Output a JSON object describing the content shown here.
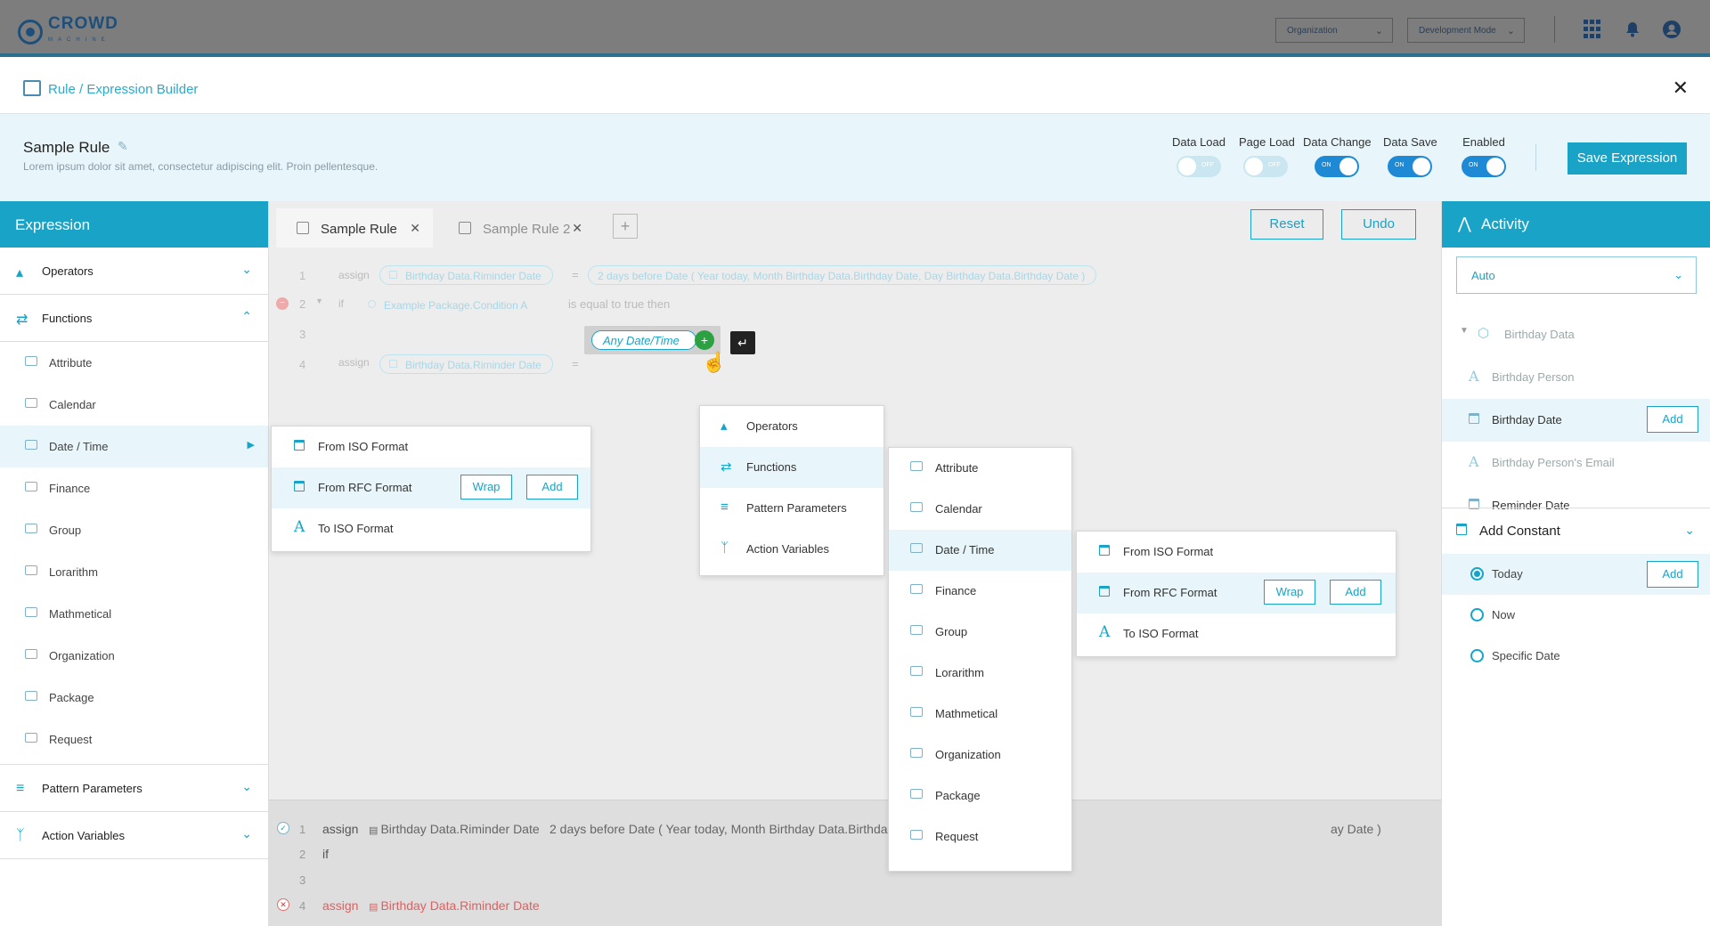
{
  "app": {
    "logo_text": "CROWD",
    "logo_sub": "MACHINE",
    "org_select": "Organization",
    "mode_select": "Development Mode"
  },
  "modal": {
    "title": "Rule / Expression Builder"
  },
  "rule": {
    "name": "Sample Rule",
    "description": "Lorem ipsum dolor sit amet, consectetur adipiscing elit. Proin pellentesque.",
    "toggles": [
      {
        "label": "Data Load",
        "state": "OFF"
      },
      {
        "label": "Page Load",
        "state": "OFF"
      },
      {
        "label": "Data Change",
        "state": "ON"
      },
      {
        "label": "Data Save",
        "state": "ON"
      },
      {
        "label": "Enabled",
        "state": "ON"
      }
    ],
    "save_label": "Save Expression"
  },
  "left": {
    "title": "Expression",
    "sections": {
      "operators": "Operators",
      "functions": "Functions",
      "pattern_parameters": "Pattern Parameters",
      "action_variables": "Action Variables"
    },
    "function_items": [
      "Attribute",
      "Calendar",
      "Date / Time",
      "Finance",
      "Group",
      "Lorarithm",
      "Mathmetical",
      "Organization",
      "Package",
      "Request"
    ],
    "active_item": "Date / Time"
  },
  "tabs": {
    "items": [
      "Sample Rule",
      "Sample Rule 2"
    ],
    "reset_label": "Reset",
    "undo_label": "Undo"
  },
  "editor": {
    "lines": {
      "l1_num": "1",
      "l1_kw": "assign",
      "l1_target": "Birthday Data.Riminder Date",
      "l1_eq": "=",
      "l1_value": "2 days before Date ( Year today, Month Birthday Data.Birthday Date, Day Birthday Data.Birthday Date )",
      "l2_num": "2",
      "l2_kw": "if",
      "l2_cond": "Example Package.Condition A",
      "l2_tail": "is equal to true then",
      "l3_num": "3",
      "l4_num": "4",
      "l4_kw": "assign",
      "l4_target": "Birthday Data.Riminder Date",
      "l4_eq": "=",
      "l4_active": "Any Date/Time"
    }
  },
  "output": {
    "o1_num": "1",
    "o1_kw": "assign",
    "o1_target": "Birthday Data.Riminder Date",
    "o1_value_a": "2 days before Date ( Year today, Month Birthday Data.Birthda",
    "o1_value_b": "ay Date )",
    "o2_num": "2",
    "o2_kw": "if",
    "o3_num": "3",
    "o4_num": "4",
    "o4_kw": "assign",
    "o4_target": "Birthday Data.Riminder Date"
  },
  "left_flyout": {
    "items": [
      "From ISO Format",
      "From RFC Format",
      "To ISO Format"
    ],
    "wrap_label": "Wrap",
    "add_label": "Add"
  },
  "ctx_menu": {
    "items": [
      "Operators",
      "Functions",
      "Pattern Parameters",
      "Action Variables"
    ]
  },
  "ctx_sub": {
    "items": [
      "Attribute",
      "Calendar",
      "Date / Time",
      "Finance",
      "Group",
      "Lorarithm",
      "Mathmetical",
      "Organization",
      "Package",
      "Request"
    ]
  },
  "ctx_flyout": {
    "items": [
      "From ISO Format",
      "From RFC Format",
      "To ISO Format"
    ],
    "wrap_label": "Wrap",
    "add_label": "Add"
  },
  "right": {
    "title": "Activity",
    "select": "Auto",
    "tree": {
      "group": "Birthday Data",
      "items": [
        "Birthday Person",
        "Birthday Date",
        "Birthday Person's Email",
        "Reminder Date"
      ],
      "add_label": "Add"
    },
    "constants_title": "Add Constant",
    "constants": [
      "Today",
      "Now",
      "Specific Date"
    ],
    "constant_add_label": "Add"
  },
  "colors": {
    "accent": "#19a3c7",
    "toggle_on": "#1e8ad6",
    "plus_green": "#2ba142",
    "error_red": "#e06060"
  }
}
